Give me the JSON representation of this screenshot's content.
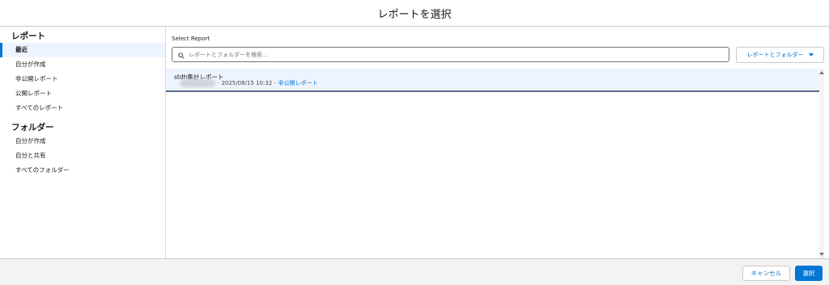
{
  "header": {
    "title": "レポートを選択"
  },
  "sidebar": {
    "reports_title": "レポート",
    "report_items": [
      {
        "label": "最近"
      },
      {
        "label": "自分が作成"
      },
      {
        "label": "非公開レポート"
      },
      {
        "label": "公開レポート"
      },
      {
        "label": "すべてのレポート"
      }
    ],
    "folders_title": "フォルダー",
    "folder_items": [
      {
        "label": "自分が作成"
      },
      {
        "label": "自分と共有"
      },
      {
        "label": "すべてのフォルダー"
      }
    ],
    "active_item": "最近"
  },
  "main": {
    "label": "Select Report",
    "search": {
      "placeholder": "レポートとフォルダーを検索...",
      "value": ""
    },
    "filter_button": {
      "label": "レポートとフォルダー"
    },
    "results": [
      {
        "title": "stdh集計レポート",
        "meta": "· 2025/08/15 10:32 ·",
        "link": "非公開レポート"
      }
    ]
  },
  "footer": {
    "cancel_label": "キャンセル",
    "select_label": "選択"
  },
  "colors": {
    "accent": "#0176d3",
    "selected_row_bg": "#eef4ff",
    "footer_bg": "#f3f3f3"
  }
}
